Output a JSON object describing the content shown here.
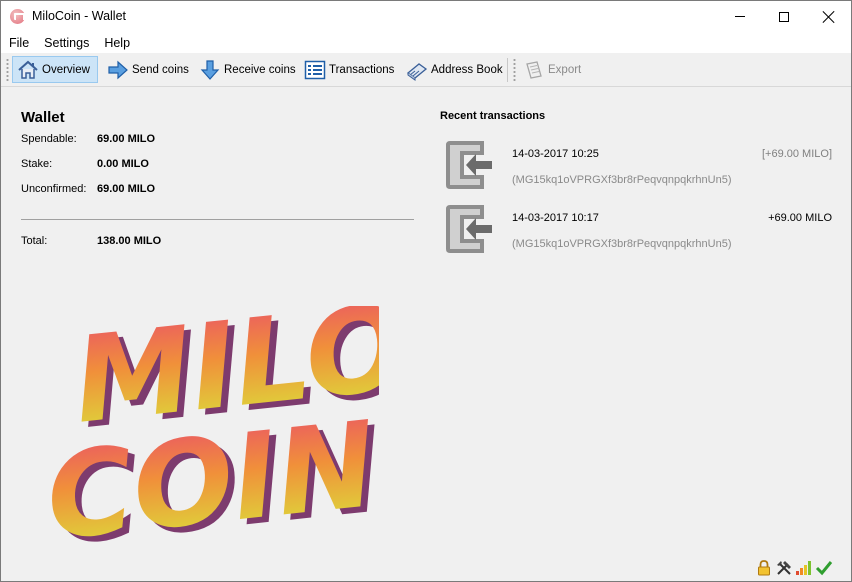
{
  "window": {
    "title": "MiloCoin - Wallet"
  },
  "menu": {
    "items": [
      "File",
      "Settings",
      "Help"
    ]
  },
  "toolbar": {
    "items": [
      {
        "label": "Overview",
        "icon": "home-icon",
        "active": true
      },
      {
        "label": "Send coins",
        "icon": "arrow-right-icon"
      },
      {
        "label": "Receive coins",
        "icon": "arrow-down-icon"
      },
      {
        "label": "Transactions",
        "icon": "list-icon"
      },
      {
        "label": "Address Book",
        "icon": "address-book-icon"
      },
      {
        "label": "Export",
        "icon": "export-icon",
        "disabled": true
      }
    ]
  },
  "wallet": {
    "title": "Wallet",
    "spendable_label": "Spendable:",
    "spendable_value": "69.00 MILO",
    "stake_label": "Stake:",
    "stake_value": "0.00 MILO",
    "unconfirmed_label": "Unconfirmed:",
    "unconfirmed_value": "69.00 MILO",
    "total_label": "Total:",
    "total_value": "138.00 MILO"
  },
  "recent": {
    "title": "Recent transactions",
    "transactions": [
      {
        "date": "14-03-2017 10:25",
        "amount": "[+69.00 MILO]",
        "address": "(MG15kq1oVPRGXf3br8rPeqvqnpqkrhnUn5)",
        "pending": true
      },
      {
        "date": "14-03-2017 10:17",
        "amount": "+69.00 MILO",
        "address": "(MG15kq1oVPRGXf3br8rPeqvqnpqkrhnUn5)",
        "pending": false
      }
    ]
  },
  "logo": {
    "line1": "MILO",
    "line2": "COIN",
    "colors": {
      "top": "#e9506a",
      "bottom": "#d8e43a",
      "shadow": "#7d3b6e"
    }
  },
  "status_icons": [
    "lock-icon",
    "staking-tools-icon",
    "connections-signal-icon",
    "synced-check-icon"
  ]
}
